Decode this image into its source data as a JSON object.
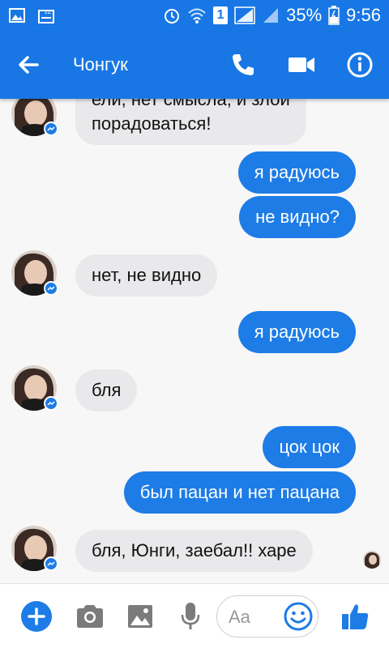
{
  "status_bar": {
    "sim_slot": "1",
    "battery_percent": "35%",
    "time": "9:56"
  },
  "header": {
    "contact_name": "Чонгук"
  },
  "messages": [
    {
      "from": "them",
      "text_top": "ели, нет смысла, и злой",
      "text": "порадоваться!"
    },
    {
      "from": "me",
      "text": "я радуюсь"
    },
    {
      "from": "me",
      "text": "не видно?"
    },
    {
      "from": "them",
      "text": "нет, не видно"
    },
    {
      "from": "me",
      "text": "я радуюсь"
    },
    {
      "from": "them",
      "text": "бля"
    },
    {
      "from": "me",
      "text": "цок цок"
    },
    {
      "from": "me",
      "text": "был пацан и нет пацана"
    },
    {
      "from": "them",
      "text": "бля, Юнги, заебал!! харе"
    }
  ],
  "composer": {
    "placeholder": "Aa"
  },
  "colors": {
    "brand": "#1877e5",
    "outgoing_bubble": "#1d7ce6",
    "incoming_bubble": "#e9e9eb"
  },
  "icons": [
    "gallery-icon",
    "sleep-icon",
    "alarm-icon",
    "wifi-icon",
    "signal-icon",
    "battery-icon",
    "back-arrow-icon",
    "phone-icon",
    "video-camera-icon",
    "info-icon",
    "add-icon",
    "camera-icon",
    "image-icon",
    "microphone-icon",
    "emoji-icon",
    "thumbs-up-icon"
  ]
}
